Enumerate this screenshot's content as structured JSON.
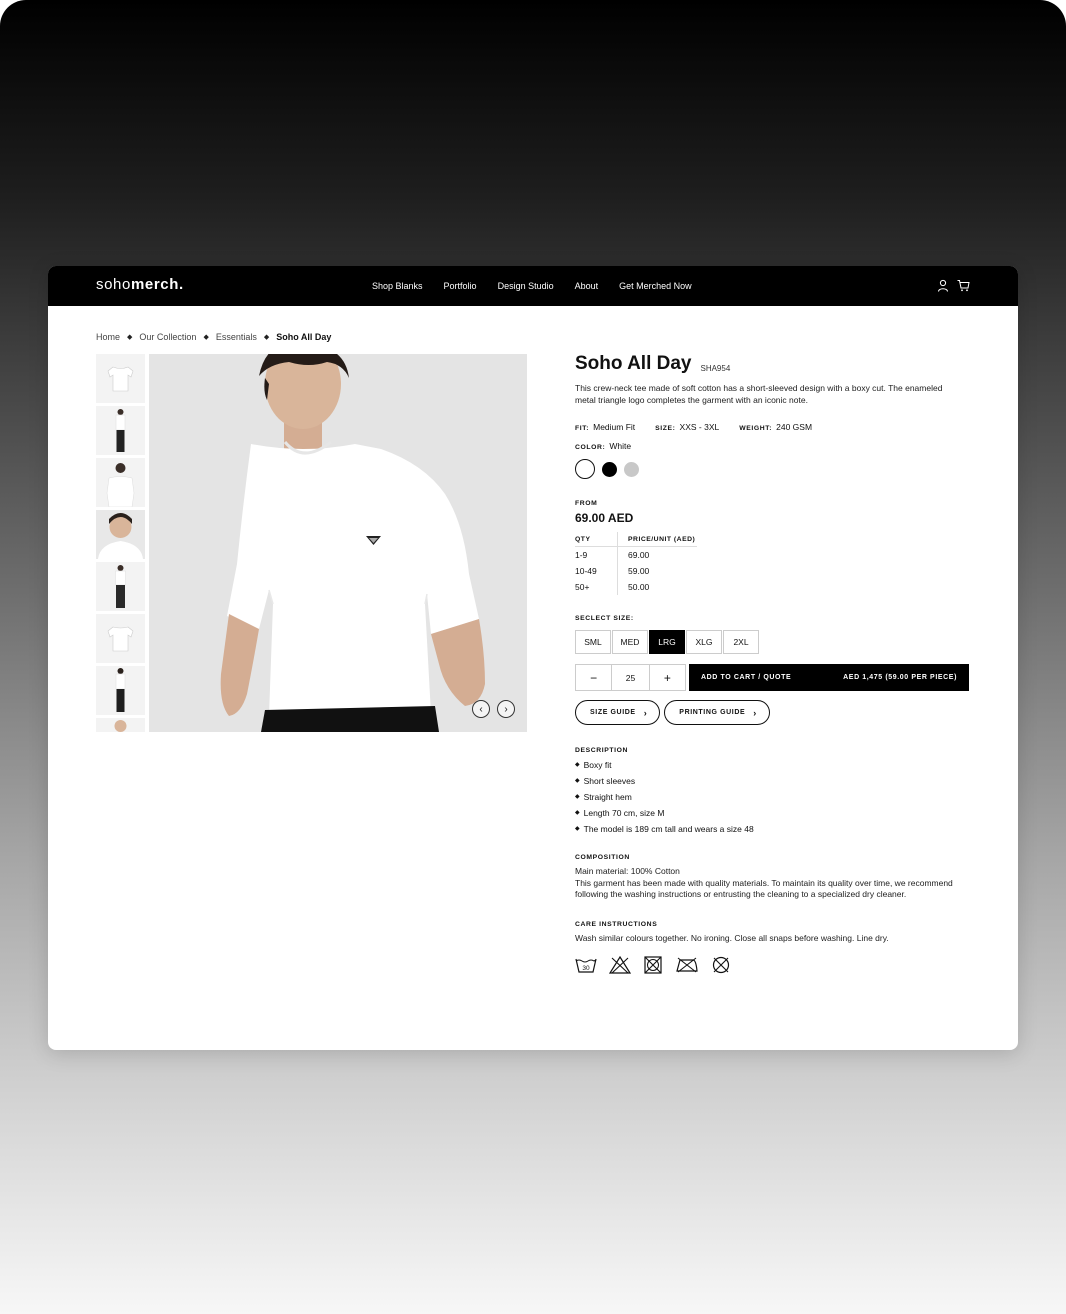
{
  "nav": {
    "logo_light": "soho",
    "logo_bold": "merch.",
    "links": [
      "Shop Blanks",
      "Portfolio",
      "Design Studio",
      "About",
      "Get Merched Now"
    ],
    "icons": [
      "user-icon",
      "cart-icon"
    ]
  },
  "breadcrumb": [
    "Home",
    "Our Collection",
    "Essentials",
    "Soho All Day"
  ],
  "product": {
    "title": "Soho All Day",
    "sku": "SHA954",
    "intro": "This crew-neck tee made of soft cotton has a short-sleeved design with a boxy cut. The enameled metal triangle logo completes the garment with an iconic note.",
    "fit_label": "FIT:",
    "fit": "Medium Fit",
    "size_label": "SIZE:",
    "size_range": "XXS - 3XL",
    "weight_label": "WEIGHT:",
    "weight": "240 GSM",
    "color_label": "COLOR:",
    "color": "White",
    "swatches": [
      "#ffffff",
      "#000000",
      "#c8c8c8"
    ],
    "from_label": "FROM",
    "price": "69.00 AED",
    "table_headers": [
      "QTY",
      "PRICE/UNIT (AED)"
    ],
    "table_rows": [
      [
        "1-9",
        "69.00"
      ],
      [
        "10-49",
        "59.00"
      ],
      [
        "50+",
        "50.00"
      ]
    ],
    "select_size_label": "SECLECT SIZE:",
    "sizes": [
      "SML",
      "MED",
      "LRG",
      "XLG",
      "2XL"
    ],
    "selected_size": "LRG",
    "quantity": "25",
    "add_to_cart_label": "ADD TO CART / QUOTE",
    "add_to_cart_total": "AED 1,475 (59.00 PER PIECE)",
    "size_guide": "SIZE GUIDE",
    "printing_guide": "PRINTING GUIDE"
  },
  "description": {
    "heading": "DESCRIPTION",
    "bullets": [
      "Boxy fit",
      "Short sleeves",
      "Straight hem",
      "Length 70 cm, size M",
      "The model is 189 cm tall and wears a size 48"
    ]
  },
  "composition": {
    "heading": "COMPOSITION",
    "main": "Main material: 100% Cotton",
    "text": "This garment has been made with quality materials. To maintain its quality over time, we recommend following the washing instructions or entrusting the cleaning to a specialized dry cleaner."
  },
  "care": {
    "heading": "CARE INSTRUCTIONS",
    "text": "Wash similar colours together. No ironing. Close all snaps before washing. Line dry.",
    "wash_temp": "30",
    "icons": [
      "wash-30-icon",
      "no-bleach-icon",
      "no-tumble-dry-icon",
      "no-iron-icon",
      "no-dry-clean-icon"
    ]
  }
}
